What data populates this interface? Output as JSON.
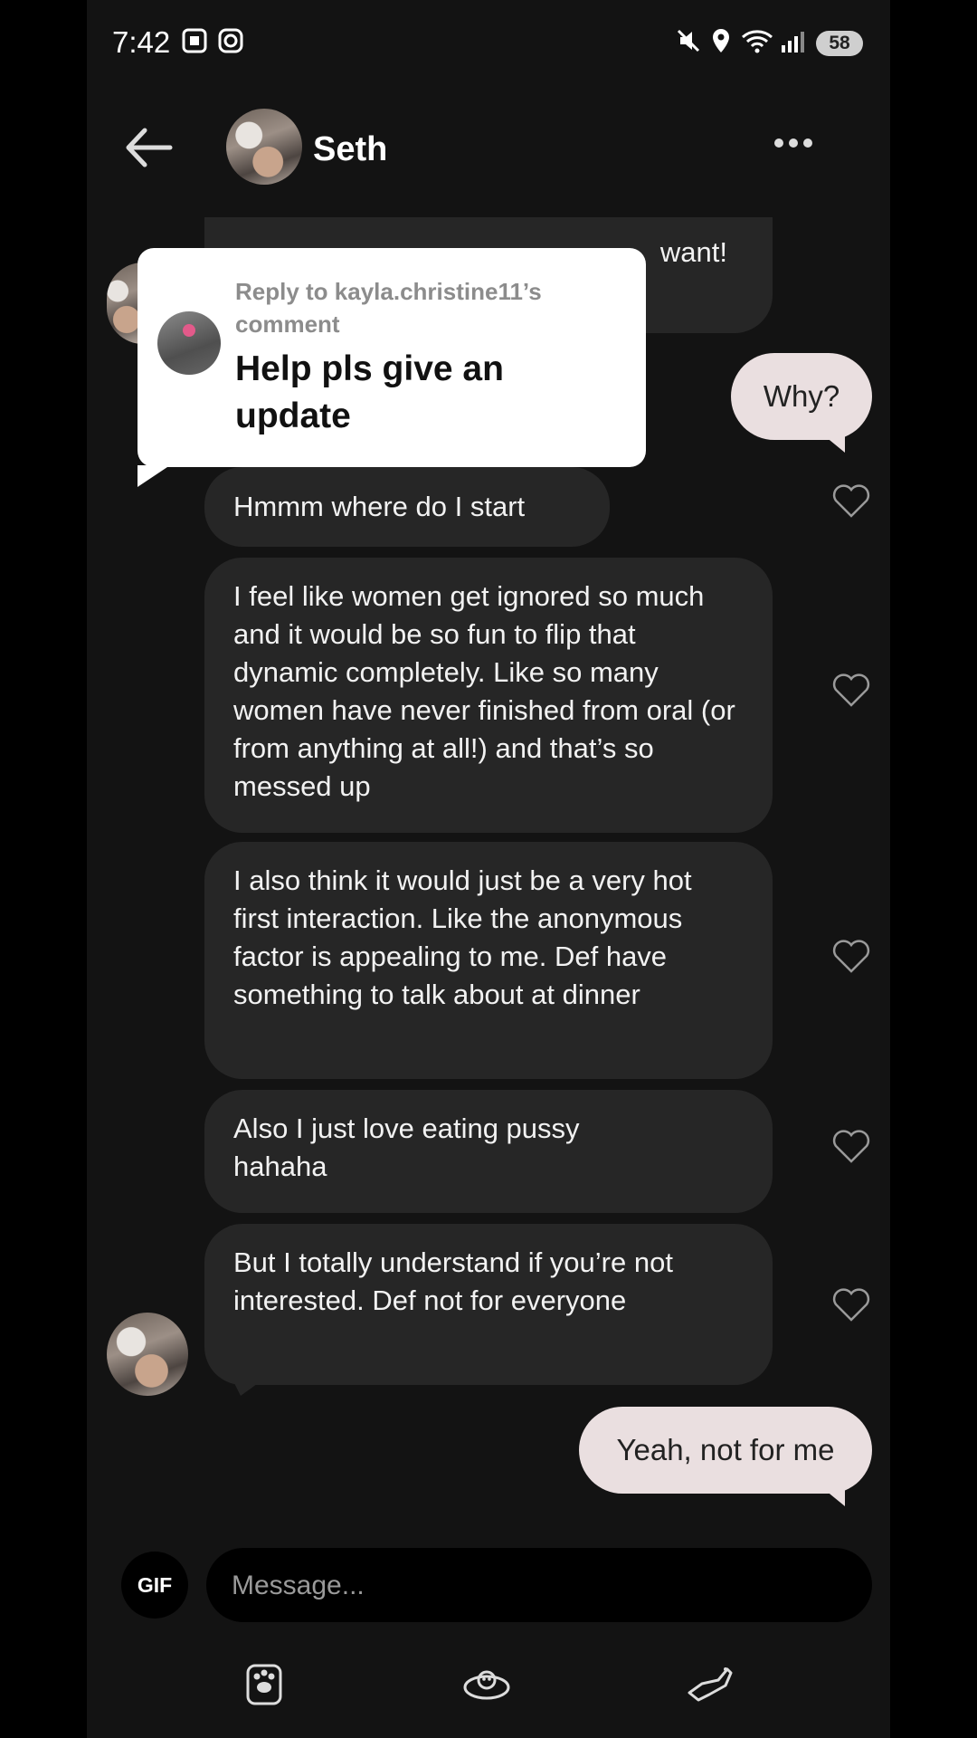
{
  "status": {
    "time": "7:42",
    "battery": "58"
  },
  "header": {
    "name": "Seth"
  },
  "messages": {
    "partial_top": "And def willing to get dinner/ drinks etc after and if you want!",
    "partial_visible": "want!",
    "why": "Why?",
    "m1": "Hmmm where do I start",
    "m2": "I feel like women get ignored so much and it would be so fun to flip that dynamic completely. Like so many women have never finished from oral (or from anything at all!) and that’s so messed up",
    "m3": "I also think it would just be a very hot first interaction. Like the anonymous factor is appealing to me. Def have something to talk about at dinner",
    "m4": "Also I just love eating pussy hahaha",
    "m5": "But I totally understand if you’re not interested. Def not for everyone",
    "reply_sent": "Yeah, not for me"
  },
  "popup": {
    "reply_label": "Reply to kayla.christine11’s comment",
    "comment": "Help pls give an update"
  },
  "composer": {
    "gif": "GIF",
    "placeholder": "Message..."
  },
  "icons": [
    "back-arrow-icon",
    "more-icon",
    "heart-icon",
    "paw-icon",
    "bed-icon",
    "cat-jump-icon"
  ]
}
